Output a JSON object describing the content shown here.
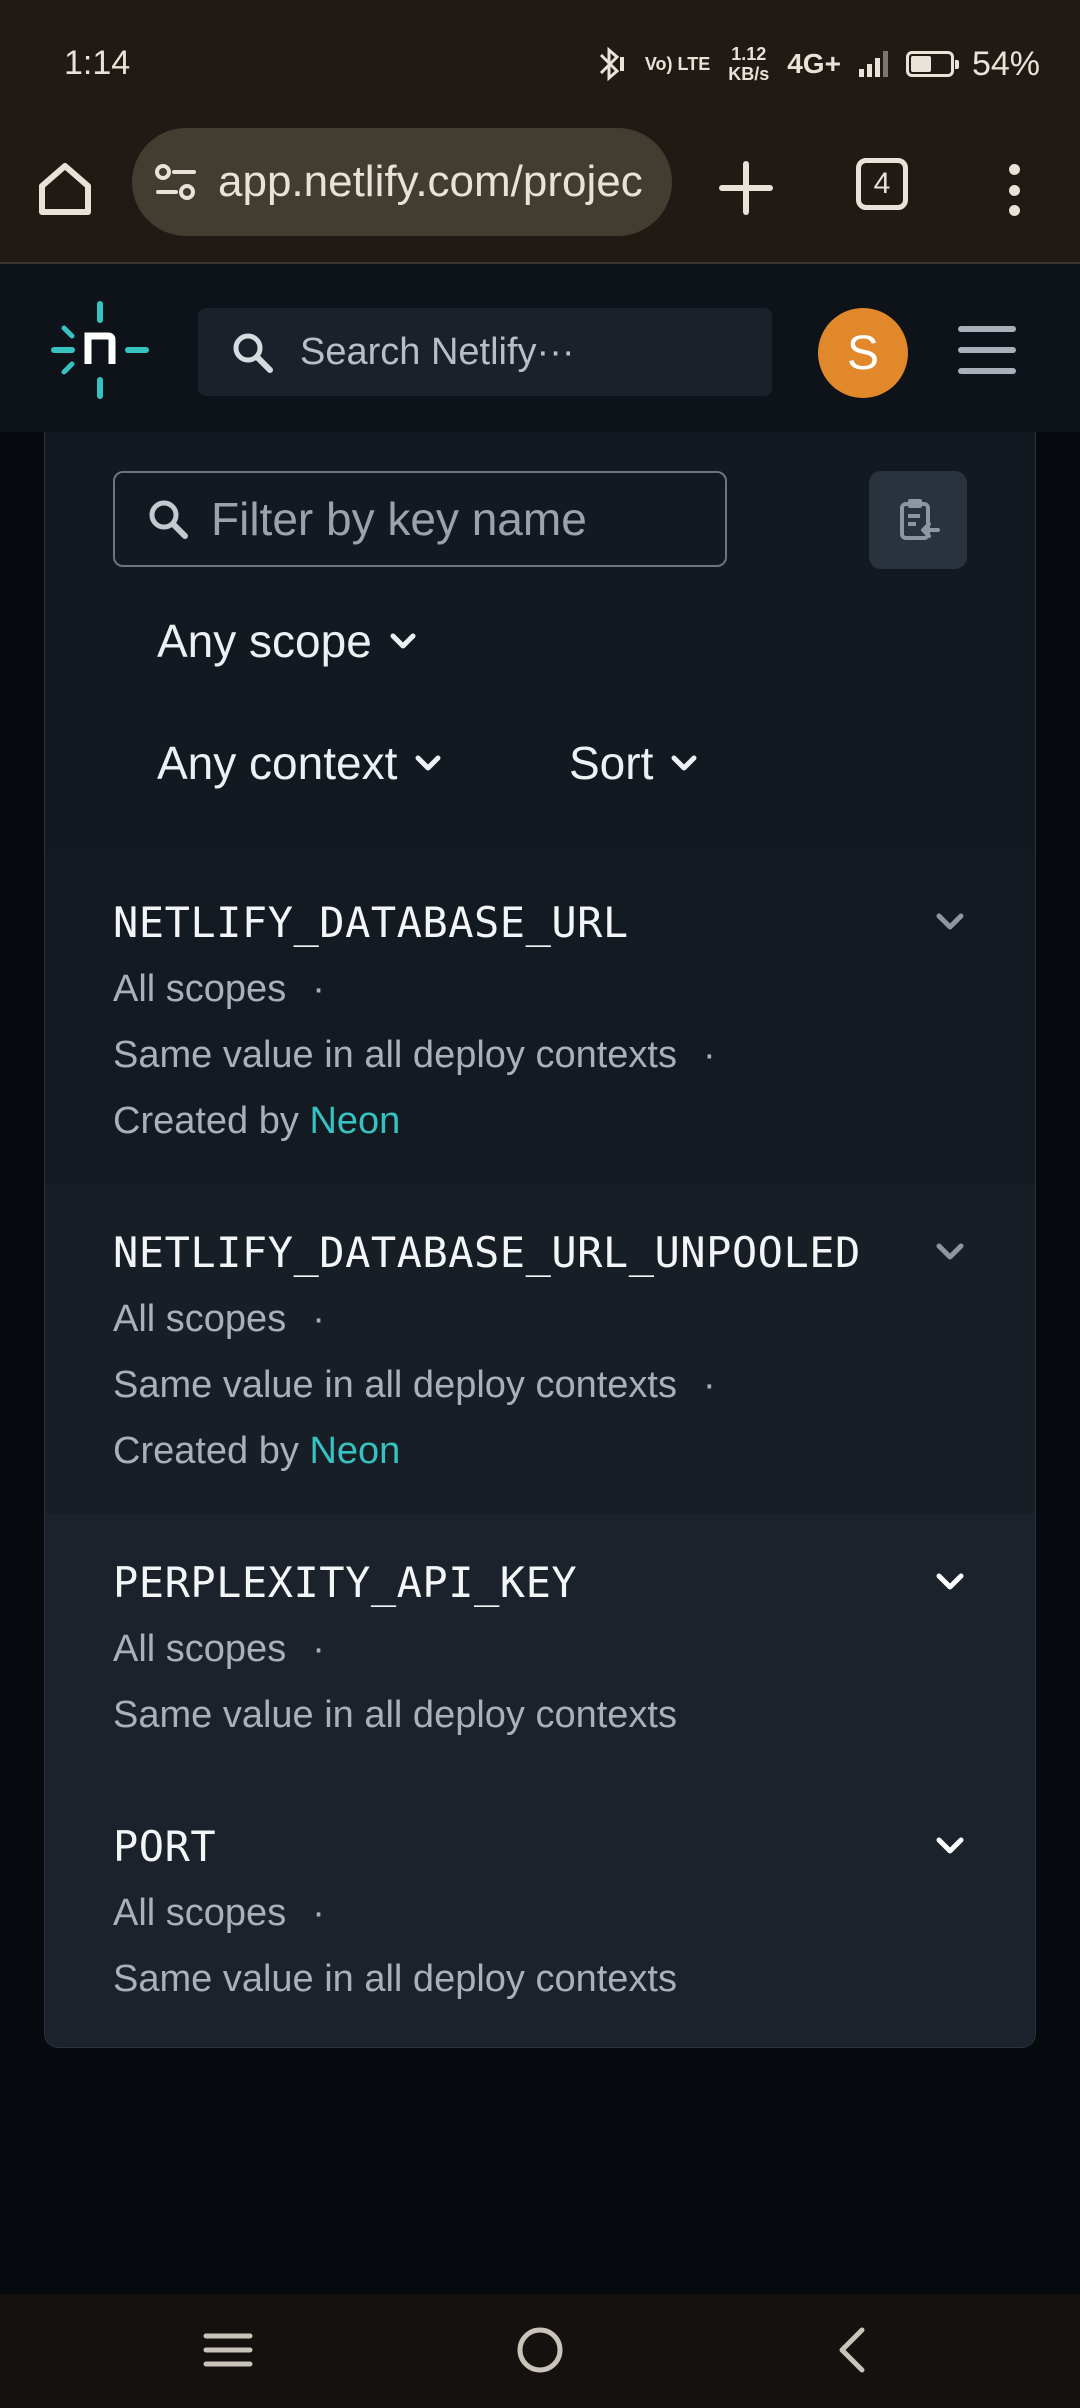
{
  "status_bar": {
    "time": "1:14",
    "volte": "Vo) LTE",
    "data_rate_value": "1.12",
    "data_rate_unit": "KB/s",
    "network": "4G+",
    "battery_pct": "54%",
    "battery_level": 0.54
  },
  "browser": {
    "url": "app.netlify.com/projec",
    "tab_count": "4"
  },
  "header": {
    "search_placeholder": "Search Netlify···",
    "avatar_initial": "S"
  },
  "filters": {
    "key_placeholder": "Filter by key name",
    "scope_label": "Any scope",
    "context_label": "Any context",
    "sort_label": "Sort"
  },
  "variables": [
    {
      "key": "NETLIFY_DATABASE_URL",
      "scopes": "All scopes",
      "contexts": "Same value in all deploy contexts",
      "created_prefix": "Created by",
      "created_by": "Neon"
    },
    {
      "key": "NETLIFY_DATABASE_URL_UNPOOLED",
      "scopes": "All scopes",
      "contexts": "Same value in all deploy contexts",
      "created_prefix": "Created by",
      "created_by": "Neon"
    },
    {
      "key": "PERPLEXITY_API_KEY",
      "scopes": "All scopes",
      "contexts": "Same value in all deploy contexts"
    },
    {
      "key": "PORT",
      "scopes": "All scopes",
      "contexts": "Same value in all deploy contexts"
    }
  ],
  "colors": {
    "accent_teal": "#35c2c0",
    "avatar_orange": "#e0882a"
  }
}
